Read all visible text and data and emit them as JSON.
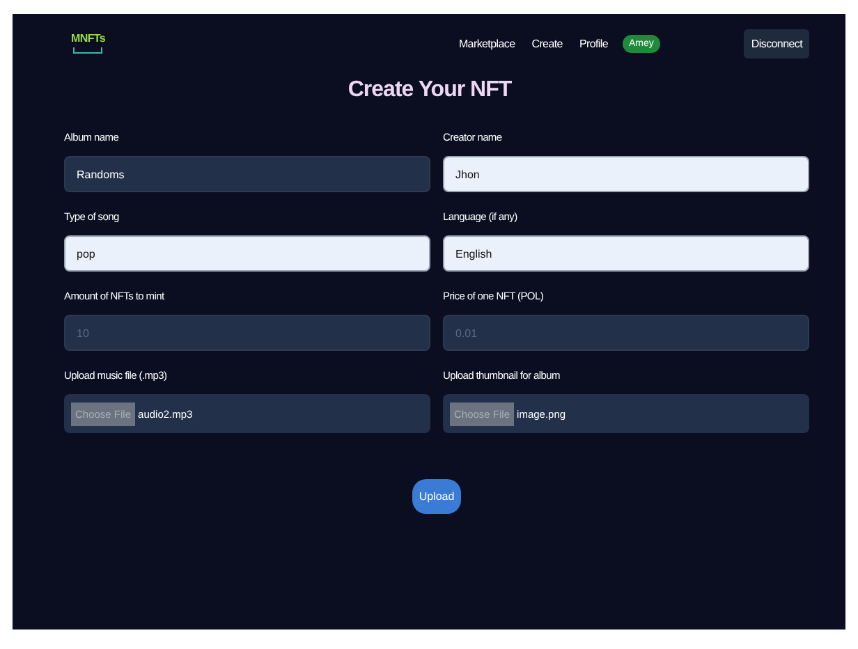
{
  "navbar": {
    "logo": "MNFTs",
    "links": [
      "Marketplace",
      "Create",
      "Profile"
    ],
    "user_badge": "Amey",
    "disconnect": "Disconnect"
  },
  "title": "Create Your NFT",
  "fields": [
    {
      "kind": "text",
      "label": "Album name",
      "value": "Randoms",
      "highlighted": false,
      "disabled": false
    },
    {
      "kind": "text",
      "label": "Creator name",
      "value": "Jhon",
      "highlighted": true,
      "disabled": false
    },
    {
      "kind": "text",
      "label": "Type of song",
      "value": "pop",
      "highlighted": true,
      "disabled": false
    },
    {
      "kind": "text",
      "label": "Language (if any)",
      "value": "English",
      "highlighted": true,
      "disabled": false
    },
    {
      "kind": "text",
      "label": "Amount of NFTs to mint",
      "value": "10",
      "highlighted": false,
      "disabled": true
    },
    {
      "kind": "text",
      "label": "Price of one NFT (POL)",
      "value": "0.01",
      "highlighted": false,
      "disabled": true
    },
    {
      "kind": "file",
      "label": "Upload music file (.mp3)",
      "button": "Choose File",
      "value": "audio2.mp3"
    },
    {
      "kind": "file",
      "label": "Upload thumbnail for album",
      "button": "Choose File",
      "value": "image.png"
    }
  ],
  "submit": "Upload"
}
